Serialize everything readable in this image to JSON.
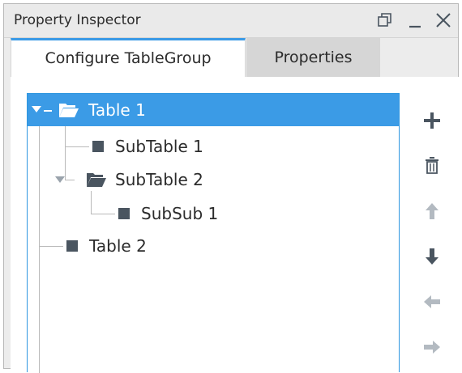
{
  "window": {
    "title": "Property Inspector",
    "controls": [
      "restore-icon",
      "minimize-icon",
      "close-icon"
    ]
  },
  "tabs": [
    {
      "label": "Configure TableGroup",
      "active": true
    },
    {
      "label": "Properties",
      "active": false
    }
  ],
  "tree": {
    "nodes": [
      {
        "label": "Table 1",
        "depth": 0,
        "type": "folder",
        "expanded": true,
        "selected": true
      },
      {
        "label": "SubTable 1",
        "depth": 1,
        "type": "leaf",
        "selected": false
      },
      {
        "label": "SubTable 2",
        "depth": 1,
        "type": "folder",
        "expanded": true,
        "selected": false
      },
      {
        "label": "SubSub 1",
        "depth": 2,
        "type": "leaf",
        "selected": false
      },
      {
        "label": "Table 2",
        "depth": 0,
        "type": "leaf",
        "selected": false
      }
    ]
  },
  "toolbar": [
    {
      "icon": "add-icon",
      "enabled": true
    },
    {
      "icon": "trash-icon",
      "enabled": true
    },
    {
      "icon": "arrow-up-icon",
      "enabled": false
    },
    {
      "icon": "arrow-down-icon",
      "enabled": true
    },
    {
      "icon": "arrow-left-icon",
      "enabled": false
    },
    {
      "icon": "arrow-right-icon",
      "enabled": false
    }
  ],
  "colors": {
    "accent": "#3b9be6",
    "enabled_icon": "#4a5560",
    "disabled_icon": "#b3bac1"
  }
}
